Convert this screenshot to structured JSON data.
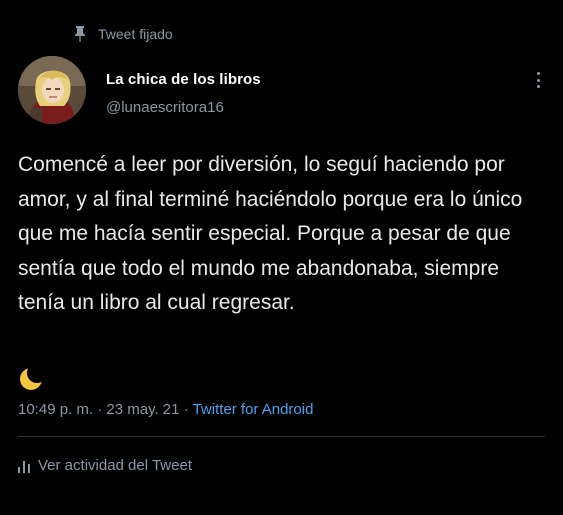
{
  "pinned": {
    "label": "Tweet fijado",
    "icon": "pin-icon"
  },
  "author": {
    "display_name": "La chica de los libros",
    "handle": "@lunaescritora16",
    "avatar_icon": "avatar-image"
  },
  "more_icon": "more-vertical-icon",
  "tweet": {
    "text": "Comencé a leer por diversión, lo seguí haciendo por amor, y al final terminé haciéndolo porque era lo único que me hacía sentir especial. Porque a pesar de que sentía que todo el mundo me abandonaba, siempre tenía un libro al cual regresar.",
    "emoji": "crescent-moon-icon"
  },
  "meta": {
    "time": "10:49 p. m.",
    "separator1": " · ",
    "date": "23 may. 21",
    "separator2": " · ",
    "source": "Twitter for Android"
  },
  "activity": {
    "label": "Ver actividad del Tweet",
    "icon": "bar-chart-icon"
  },
  "colors": {
    "background": "#000000",
    "text": "#e7e9ea",
    "secondary": "#8b98a5",
    "link": "#4aa2f0",
    "divider": "#2f3336",
    "moon": "#f5c542"
  }
}
